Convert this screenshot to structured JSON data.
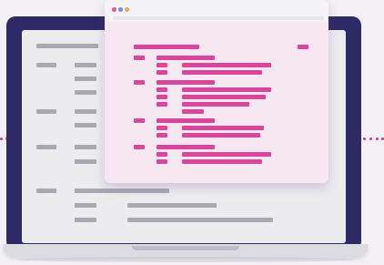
{
  "colors": {
    "background": "#f3f1f5",
    "laptop_frame": "#2f2a66",
    "screen": "#ececef",
    "screen_lines": "#a9a9b2",
    "laptop_base": "#dcdbe2",
    "base_notch": "#bdbcc8",
    "code_window": "#f7e7f1",
    "code_window_header": "#f4f3f6",
    "code_lines": "#d9479c",
    "dotted_connector": "#c2388a"
  },
  "window_buttons": [
    {
      "name": "close",
      "color": "#e9558e"
    },
    {
      "name": "minimize",
      "color": "#6d8fe0"
    },
    {
      "name": "maximize",
      "color": "#f2a25c"
    }
  ],
  "icons": [
    "laptop-icon",
    "code-window-icon",
    "dotted-connector-icon"
  ]
}
